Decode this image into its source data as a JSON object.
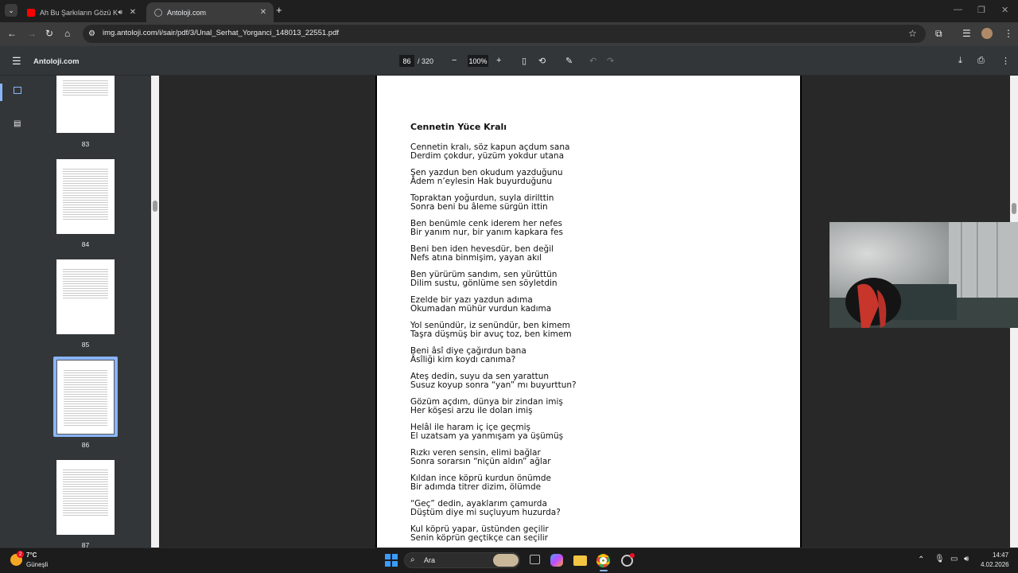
{
  "tabs": [
    {
      "title": "Ah Bu Şarkıların Gözü Kör O",
      "favicon": "youtube-icon",
      "color": "#ff0000"
    },
    {
      "title": "Antoloji.com",
      "favicon": "globe-icon",
      "color": "#9aa0a6"
    }
  ],
  "address_bar": {
    "url": "img.antoloji.com/i/sair/pdf/3/Unal_Serhat_Yorganci_148013_22551.pdf"
  },
  "pdf_toolbar": {
    "title": "Antoloji.com",
    "current_page": "86",
    "page_total": "/ 320",
    "zoom": "100%"
  },
  "thumbnails": [
    {
      "label": "83"
    },
    {
      "label": "84"
    },
    {
      "label": "85"
    },
    {
      "label": "86",
      "selected": true
    },
    {
      "label": "87"
    }
  ],
  "poem": {
    "title": "Cennetin Yüce Kralı",
    "stanzas": [
      "Cennetin kralı, söz kapun açdum sana\nDerdim çokdur, yüzüm yokdur utana",
      "Şen yazdun ben okudum yazduğunu\nÂdem n’eylesin Hak buyurduğunu",
      "Topraktan yoğurdun, suyla dirilttin\nSonra beni bu âleme sürgün ittin",
      "Ben benümle cenk iderem her nefes\nBir yanım nur, bir yanım kapkara fes",
      "Beni ben iden hevesdür, ben değil\nNefs atına binmişim, yayan akıl",
      "Ben yürürüm sandım, sen yürüttün\nDilim sustu, gönlüme sen söyletdin",
      "Ezelde bir yazı yazdun adıma\nOkumadan mühür vurdun kadıma",
      "Yol senündür, iz senündür, ben kimem\nTaşra düşmüş bir avuç toz, ben kimem",
      "Beni âsî diye çağırdun bana\nÂsîliği kim koydı canıma?",
      "Ateş dedin, suyu da sen yarattun\nSusuz koyup sonra “yan” mı buyurttun?",
      "Gözüm açdım, dünya bir zindan imiş\nHer köşesi arzu ile dolan imiş",
      "Helâl ile haram iç içe geçmiş\nEl uzatsam ya yanmışam ya üşümüş",
      "Rızkı veren sensin, elimi bağlar\nSonra sorarsın “niçün aldın” ağlar",
      "Kıldan ince köprü kurdun önümde\nBir adımda titrer dizim, ölümde",
      "“Geç” dedin, ayaklarım çamurda\nDüştüm diye mi suçluyum huzurda?",
      "Kul köprü yapar, üstünden geçilir\nSenin köprün geçtikçe can seçilir"
    ]
  },
  "taskbar": {
    "weather_temp": "7°C",
    "weather_desc": "Güneşli",
    "weather_badge": "2",
    "search_label": "Ara",
    "time": "14:47",
    "date": "4.02.2026"
  },
  "colors": {
    "accent": "#8ab4f8",
    "toolbar": "#3c3c3c",
    "pdf_toolbar": "#323639"
  }
}
